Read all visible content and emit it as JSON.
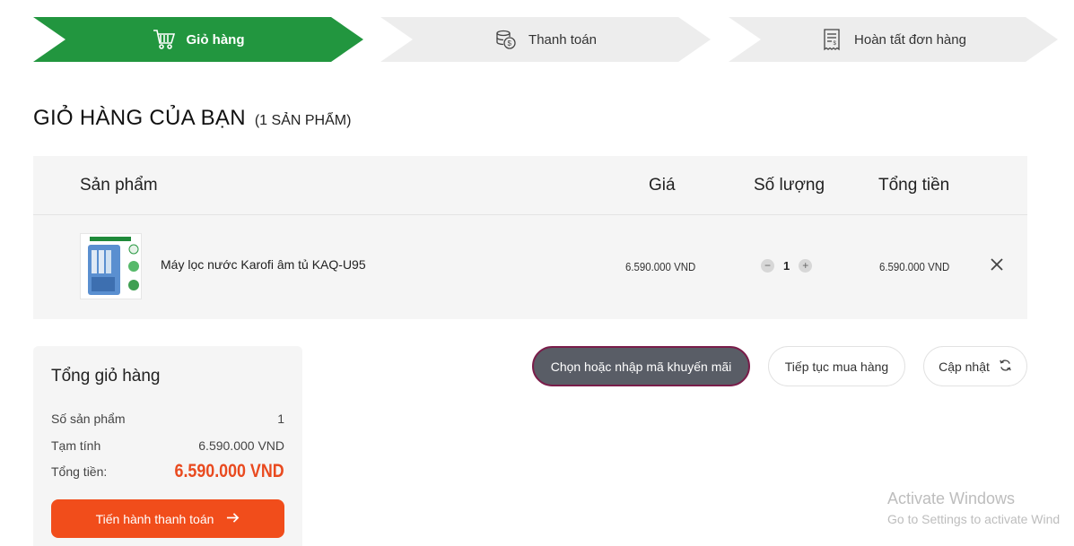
{
  "steps": [
    {
      "label": "Giỏ hàng",
      "icon": "cart-icon",
      "active": true
    },
    {
      "label": "Thanh toán",
      "icon": "money-icon",
      "active": false
    },
    {
      "label": "Hoàn tất đơn hàng",
      "icon": "bill-icon",
      "active": false
    }
  ],
  "colors": {
    "active_step": "#22963f",
    "inactive_step": "#ededed",
    "accent": "#f14d1b",
    "promo_bg": "#595d66"
  },
  "cart": {
    "title": "GIỎ HÀNG CỦA BẠN",
    "count_label": "(1 SẢN PHẨM)",
    "headers": {
      "product": "Sản phẩm",
      "price": "Giá",
      "quantity": "Số lượng",
      "total": "Tổng tiền"
    },
    "items": [
      {
        "name": "Máy lọc nước Karofi âm tủ KAQ-U95",
        "price": "6.590.000 VND",
        "quantity": "1",
        "total": "6.590.000 VND"
      }
    ]
  },
  "summary": {
    "title": "Tổng giỏ hàng",
    "items_label": "Số sản phẩm",
    "items_value": "1",
    "subtotal_label": "Tạm tính",
    "subtotal_value": "6.590.000 VND",
    "total_label": "Tổng tiền:",
    "total_value": "6.590.000 VND",
    "checkout_label": "Tiến hành thanh toán"
  },
  "actions": {
    "promo_label": "Chọn hoặc nhập mã khuyến mãi",
    "continue_label": "Tiếp tục mua hàng",
    "update_label": "Cập nhật"
  },
  "watermark": {
    "line1": "Activate Windows",
    "line2": "Go to Settings to activate Wind"
  }
}
